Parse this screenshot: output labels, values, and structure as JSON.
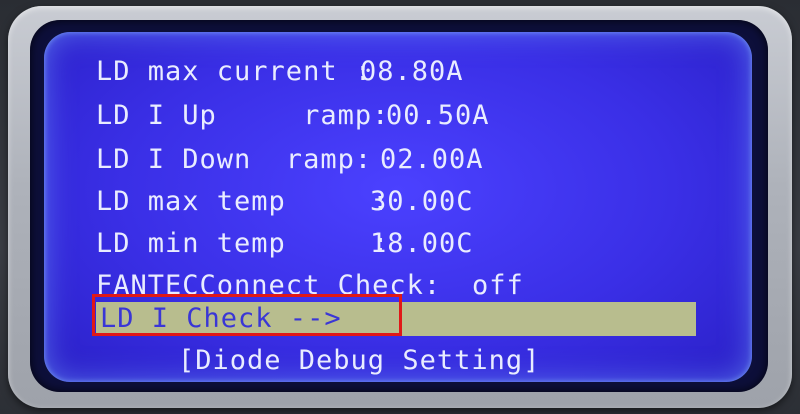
{
  "menu": {
    "rows": [
      {
        "label": "LD max current :",
        "value": "08.80A"
      },
      {
        "label": "LD I Up     ramp:",
        "value": "00.50A"
      },
      {
        "label": "LD I Down  ramp:",
        "value": "02.00A"
      },
      {
        "label": "LD max temp     :",
        "value": "30.00C"
      },
      {
        "label": "LD min temp     :",
        "value": "18.00C"
      },
      {
        "label": "FANTECConnect Check:",
        "value": "off"
      }
    ],
    "selected_item": "LD I Check -->",
    "submenu_link": "[Diode Debug Setting]"
  }
}
